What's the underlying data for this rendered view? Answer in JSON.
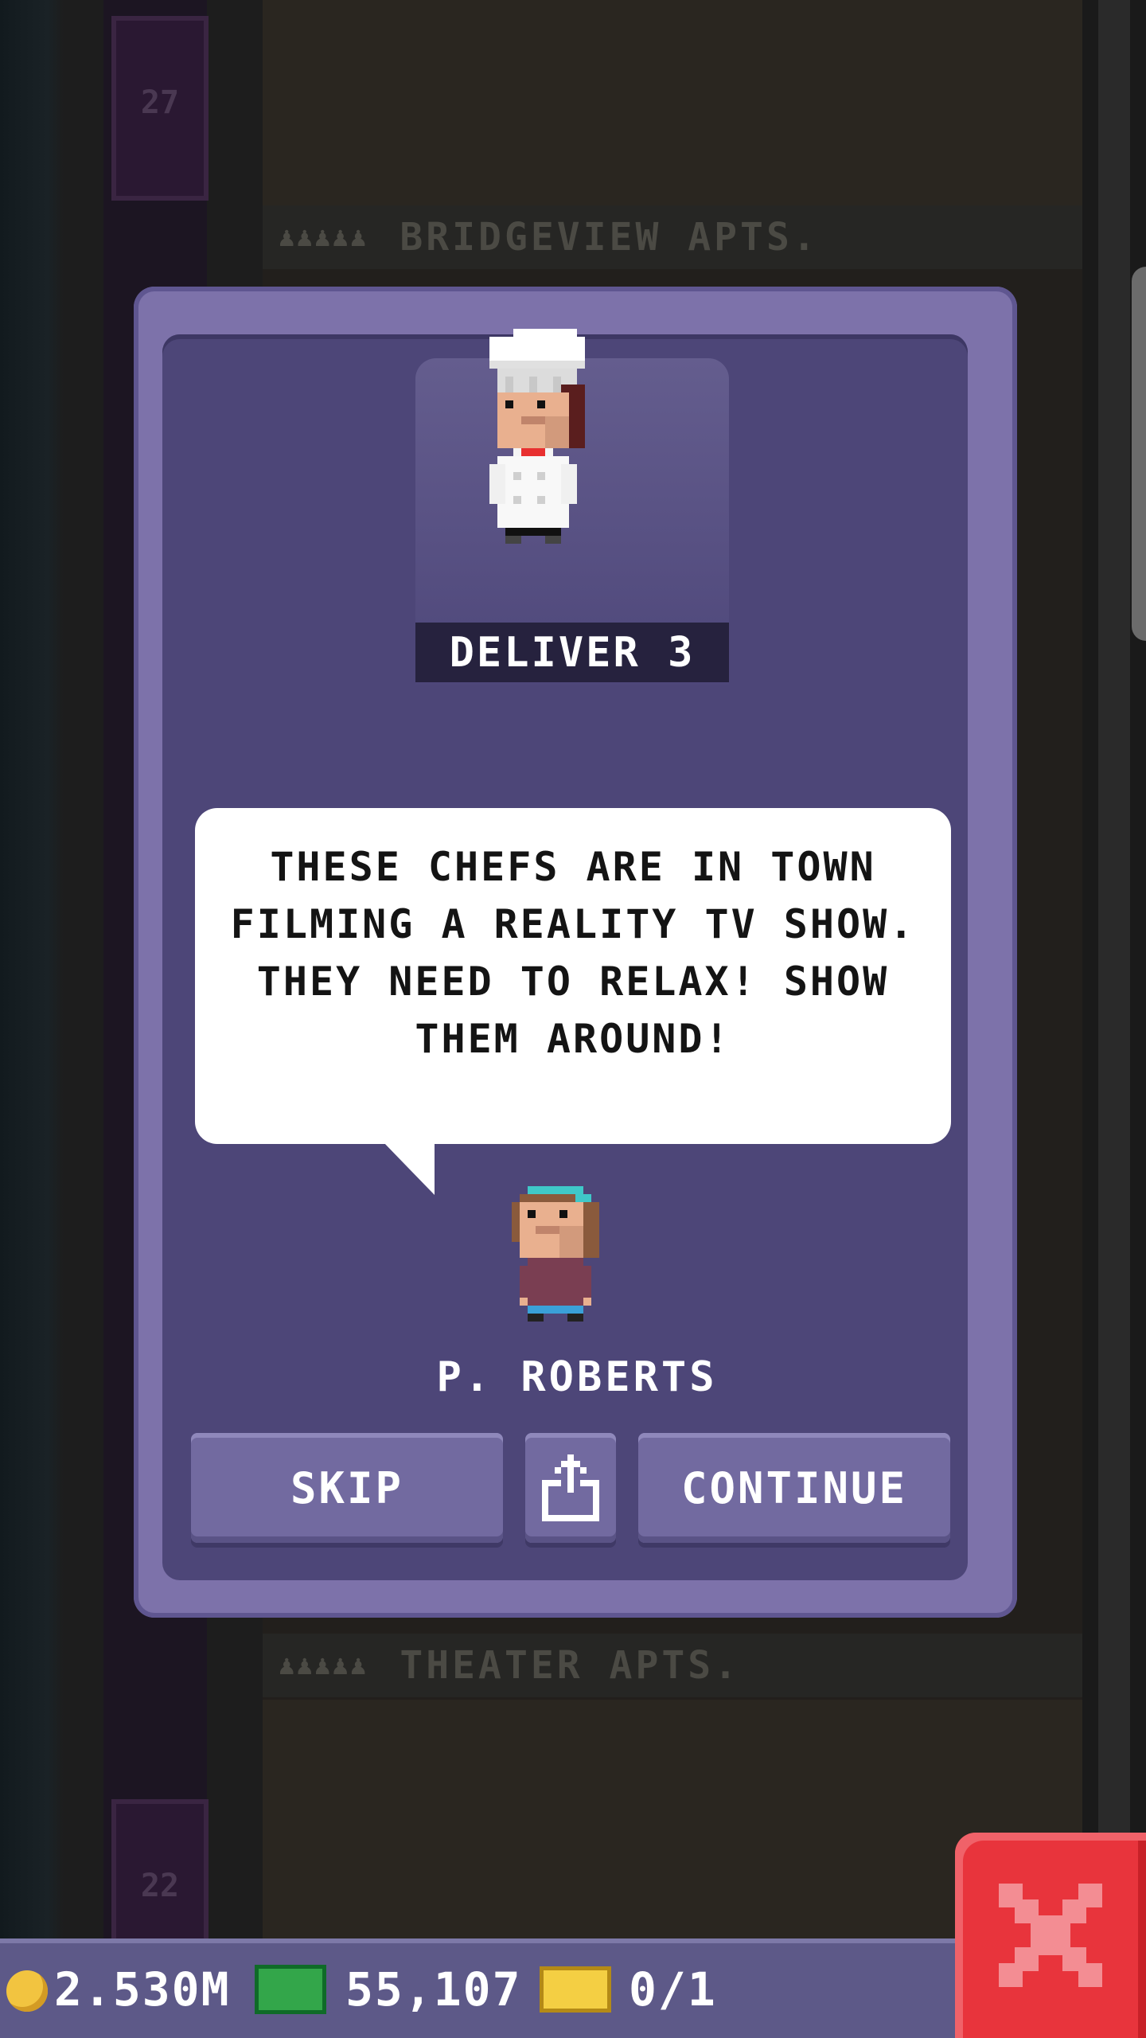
{
  "background": {
    "elevator_floor_top": "27",
    "elevator_floor_bottom": "22",
    "floor_upper_name": "BRIDGEVIEW APTS.",
    "floor_lower_name": "THEATER APTS."
  },
  "mission": {
    "task_label": "DELIVER 3",
    "dialog_text": "THESE CHEFS ARE IN TOWN FILMING A REALITY TV SHOW. THEY NEED TO RELAX! SHOW THEM AROUND!",
    "npc_name": "P. ROBERTS",
    "character_icon": "chef-icon",
    "npc_icon": "resident-icon"
  },
  "buttons": {
    "skip": "SKIP",
    "share_icon": "share-icon",
    "continue": "CONTINUE"
  },
  "status_bar": {
    "coins": "2.530M",
    "bux": "55,107",
    "tickets": "0/1"
  },
  "colors": {
    "modal_outer": "#7d72aa",
    "modal_inner": "#4d4678",
    "button": "#726aa0",
    "close_red": "#e8343c",
    "status_bar": "#5d5988"
  }
}
